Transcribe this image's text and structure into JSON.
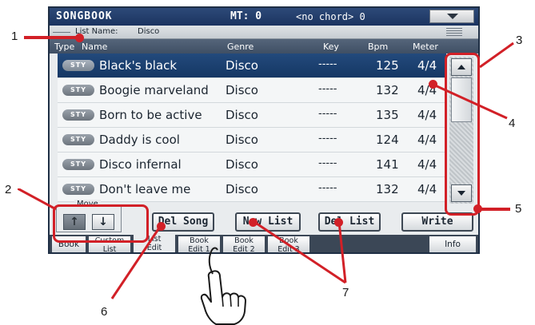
{
  "header": {
    "title": "SONGBOOK",
    "mt": "MT: 0",
    "chord": "<no chord> 0"
  },
  "list_name": {
    "label": "List Name:",
    "value": "Disco"
  },
  "columns": [
    "Type",
    "Name",
    "Genre",
    "Key",
    "Bpm",
    "Meter"
  ],
  "rows": [
    {
      "type": "STY",
      "name": "Black's black",
      "genre": "Disco",
      "key": "-----",
      "bpm": "125",
      "meter": "4/4",
      "selected": true
    },
    {
      "type": "STY",
      "name": "Boogie marveland",
      "genre": "Disco",
      "key": "-----",
      "bpm": "132",
      "meter": "4/4"
    },
    {
      "type": "STY",
      "name": "Born to be active",
      "genre": "Disco",
      "key": "-----",
      "bpm": "135",
      "meter": "4/4"
    },
    {
      "type": "STY",
      "name": "Daddy is cool",
      "genre": "Disco",
      "key": "-----",
      "bpm": "124",
      "meter": "4/4"
    },
    {
      "type": "STY",
      "name": "Disco infernal",
      "genre": "Disco",
      "key": "-----",
      "bpm": "141",
      "meter": "4/4"
    },
    {
      "type": "STY",
      "name": "Don't leave me",
      "genre": "Disco",
      "key": "-----",
      "bpm": "132",
      "meter": "4/4"
    }
  ],
  "move": {
    "label": "Move",
    "up": "↑",
    "down": "↓"
  },
  "buttons": {
    "del_song": "Del Song",
    "new_list": "New List",
    "del_list": "Del List",
    "write": "Write"
  },
  "tabs": [
    {
      "line1": "Book",
      "line2": ""
    },
    {
      "line1": "Custom",
      "line2": "List"
    },
    {
      "line1": "List",
      "line2": "Edit",
      "active": true
    },
    {
      "line1": "Book",
      "line2": "Edit 1"
    },
    {
      "line1": "Book",
      "line2": "Edit 2"
    },
    {
      "line1": "Book",
      "line2": "Edit 3"
    },
    {
      "line1": "Info",
      "line2": ""
    }
  ],
  "callouts": [
    "1",
    "2",
    "3",
    "4",
    "5",
    "6",
    "7"
  ],
  "colors": {
    "callout": "#d22027",
    "titlebar": "#1b3360",
    "selection": "#153764"
  }
}
